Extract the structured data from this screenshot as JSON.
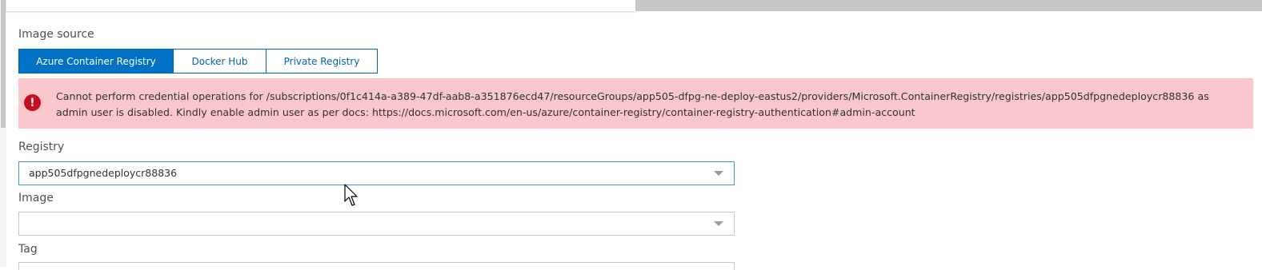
{
  "image_source": {
    "label": "Image source",
    "tabs": [
      {
        "label": "Azure Container Registry",
        "active": true
      },
      {
        "label": "Docker Hub",
        "active": false
      },
      {
        "label": "Private Registry",
        "active": false
      }
    ]
  },
  "error": {
    "icon": "error-exclamation-icon",
    "message": "Cannot perform credential operations for /subscriptions/0f1c414a-a389-47df-aab8-a351876ecd47/resourceGroups/app505-dfpg-ne-deploy-eastus2/providers/Microsoft.ContainerRegistry/registries/app505dfpgnedeploycr88836 as admin user is disabled. Kindly enable admin user as per docs: https://docs.microsoft.com/en-us/azure/container-registry/container-registry-authentication#admin-account",
    "color": "#fac8cc"
  },
  "registry": {
    "label": "Registry",
    "value": "app505dfpgnedeploycr88836"
  },
  "image": {
    "label": "Image",
    "value": ""
  },
  "tag": {
    "label": "Tag"
  },
  "colors": {
    "accent": "#0072c6",
    "error_icon": "#c50f1f"
  }
}
